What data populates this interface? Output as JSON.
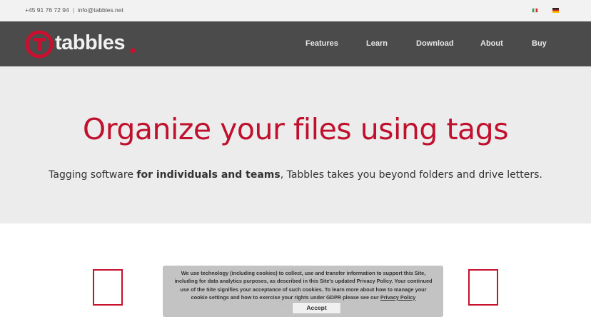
{
  "topbar": {
    "phone": "+45 91 76 72 94",
    "separator": "|",
    "email": "info@tabbles.net",
    "flags": [
      "flag-italy-icon",
      "flag-germany-icon"
    ]
  },
  "navbar": {
    "logo_text": "tabbles",
    "items": [
      {
        "label": "Features"
      },
      {
        "label": "Learn"
      },
      {
        "label": "Download"
      },
      {
        "label": "About"
      },
      {
        "label": "Buy"
      }
    ]
  },
  "hero": {
    "title": "Organize your files using tags",
    "subtitle_pre": "Tagging software ",
    "subtitle_bold": "for individuals and teams",
    "subtitle_post": ", Tabbles takes you beyond folders and drive letters."
  },
  "cookie": {
    "text": "We use technology (including cookies) to collect, use and transfer information to support this Site, including for data analytics purposes, as described in this Site's updated Privacy Policy. Your continued use of the Site signifies your acceptance of such cookies. To learn more about how to manage your cookie settings and how to exercise your rights under GDPR please see our ",
    "link": "Privacy Policy",
    "accept_label": "Accept"
  },
  "colors": {
    "brand_red": "#c0102e",
    "nav_bg": "#4b4b4b",
    "hero_bg": "#ececec"
  }
}
